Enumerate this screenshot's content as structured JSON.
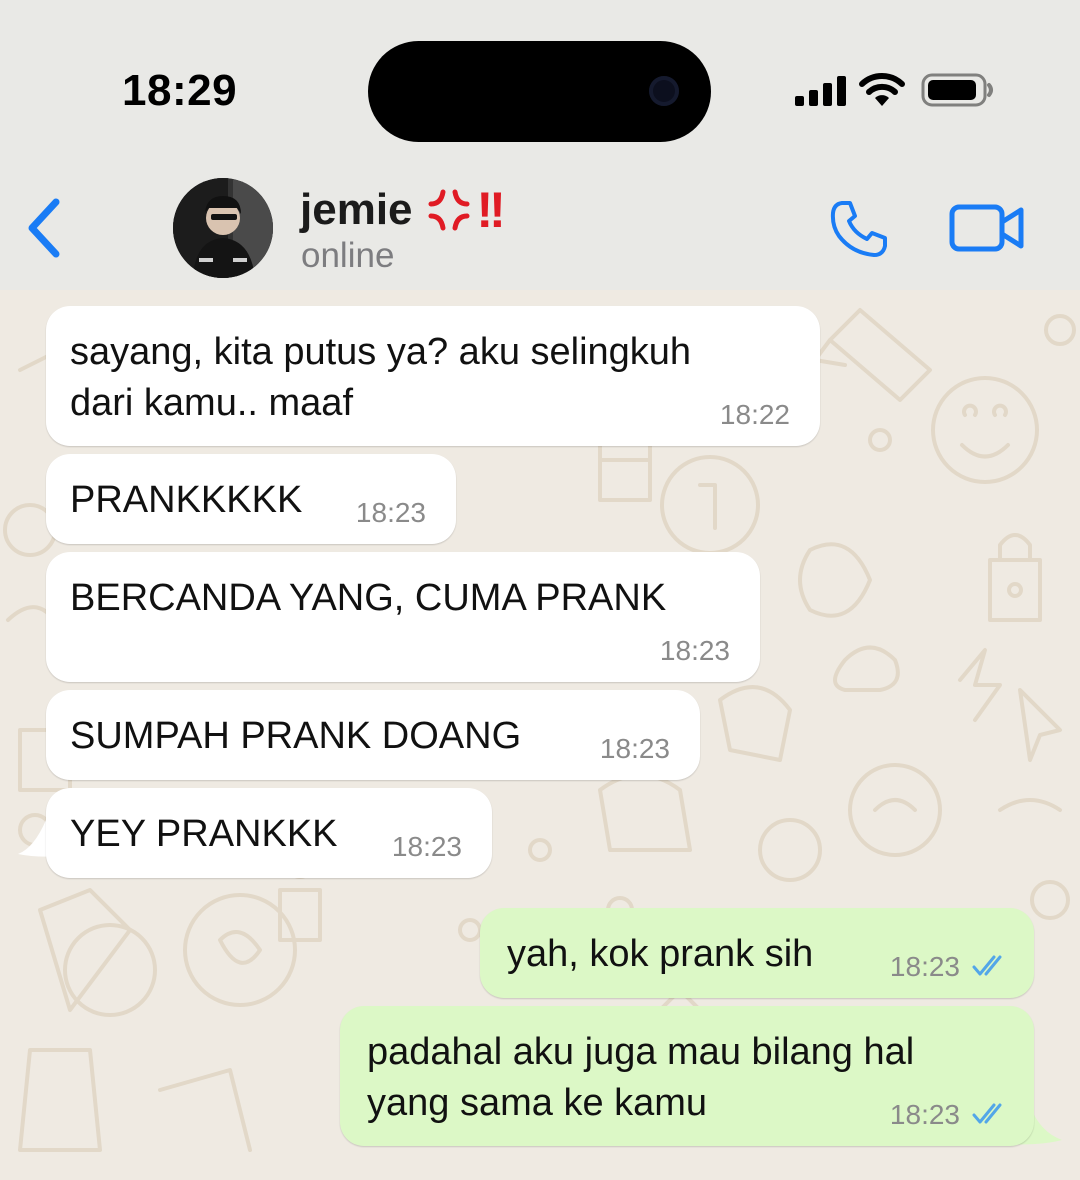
{
  "status_bar": {
    "time": "18:29"
  },
  "header": {
    "contact_name": "jemie",
    "name_emoji_icon": "anger-symbol-icon",
    "name_exclamation": "!!",
    "status": "online",
    "back_icon": "chevron-left-icon",
    "call_icon": "phone-icon",
    "video_icon": "video-camera-icon",
    "accent_color": "#1a7cf5"
  },
  "messages": [
    {
      "direction": "incoming",
      "text": "sayang, kita putus ya? aku selingkuh\ndari kamu.. maaf",
      "time": "18:22"
    },
    {
      "direction": "incoming",
      "text": "PRANKKKKK",
      "time": "18:23"
    },
    {
      "direction": "incoming",
      "text": "BERCANDA YANG, CUMA PRANK",
      "time": "18:23"
    },
    {
      "direction": "incoming",
      "text": "SUMPAH PRANK DOANG",
      "time": "18:23"
    },
    {
      "direction": "incoming",
      "text": "YEY PRANKKK",
      "time": "18:23"
    },
    {
      "direction": "outgoing",
      "text": "yah, kok prank sih",
      "time": "18:23",
      "read_icon": "double-check-read-icon"
    },
    {
      "direction": "outgoing",
      "text": "padahal aku juga mau bilang hal\nyang sama ke kamu",
      "time": "18:23",
      "read_icon": "double-check-read-icon"
    }
  ],
  "colors": {
    "incoming_bubble": "#ffffff",
    "outgoing_bubble": "#dcf8c6",
    "chat_background": "#efeae2",
    "read_ticks": "#53a6e8"
  }
}
